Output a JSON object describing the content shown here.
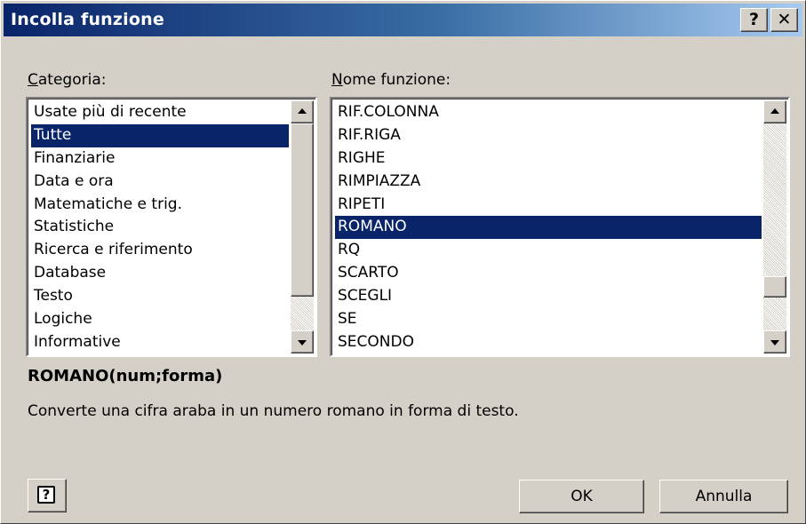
{
  "window": {
    "title": "Incolla funzione",
    "help_glyph": "?",
    "close_glyph": "✕"
  },
  "category": {
    "label_accel": "C",
    "label_rest": "ategoria:",
    "items": [
      "Usate più di recente",
      "Tutte",
      "Finanziarie",
      "Data e ora",
      "Matematiche e trig.",
      "Statistiche",
      "Ricerca e riferimento",
      "Database",
      "Testo",
      "Logiche",
      "Informative"
    ],
    "selected": "Tutte"
  },
  "function_list": {
    "label_accel": "N",
    "label_rest": "ome funzione:",
    "items": [
      "RIF.COLONNA",
      "RIF.RIGA",
      "RIGHE",
      "RIMPIAZZA",
      "RIPETI",
      "ROMANO",
      "RQ",
      "SCARTO",
      "SCEGLI",
      "SE",
      "SECONDO"
    ],
    "selected": "ROMANO"
  },
  "details": {
    "signature": "ROMANO(num;forma)",
    "description": "Converte una cifra araba in un numero romano in forma di testo."
  },
  "buttons": {
    "help_icon_glyph": "?",
    "ok": "OK",
    "cancel": "Annulla"
  },
  "icons": {
    "help_button": "question-mark-help-icon",
    "close_button": "close-icon",
    "scroll_up": "arrow-up-icon",
    "scroll_down": "arrow-down-icon"
  },
  "colors": {
    "selection": "#0a246a",
    "title_start": "#0a246a",
    "title_end": "#a6caf0",
    "face": "#d4d0c8"
  }
}
